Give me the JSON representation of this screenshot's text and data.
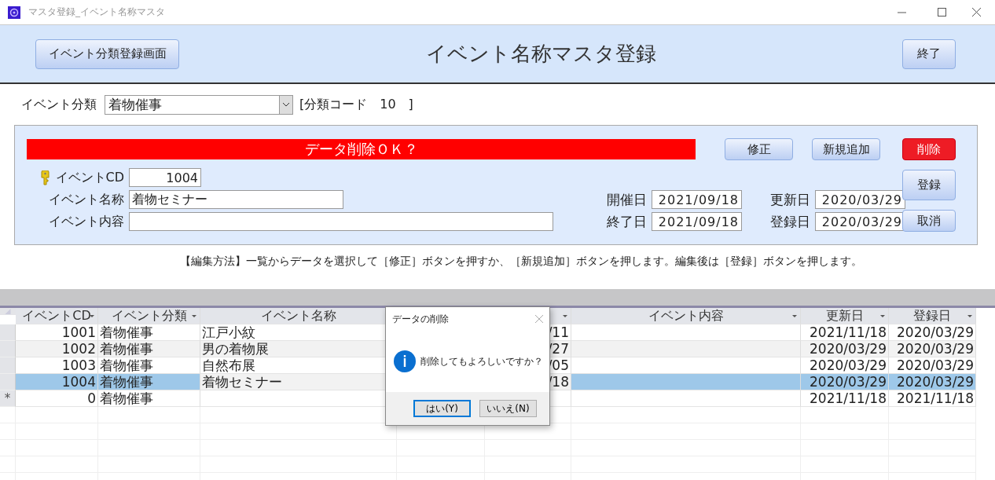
{
  "window": {
    "title": "マスタ登録_イベント名称マスタ"
  },
  "header": {
    "nav_button": "イベント分類登録画面",
    "title": "イベント名称マスタ登録",
    "close_button": "終了"
  },
  "category": {
    "label": "イベント分類",
    "value": "着物催事",
    "code_text": "[分類コード　10　]"
  },
  "editor": {
    "alert": "データ削除ＯＫ？",
    "top_buttons": [
      {
        "label": "修正",
        "kind": "normal"
      },
      {
        "label": "新規追加",
        "kind": "normal"
      }
    ],
    "side_buttons": [
      {
        "label": "削除",
        "kind": "danger"
      },
      {
        "label": "登録",
        "kind": "tall"
      },
      {
        "label": "取消",
        "kind": "normal"
      }
    ],
    "fields": [
      {
        "label": "イベントCD",
        "value": "1004",
        "kind": "key"
      },
      {
        "label": "イベント名称",
        "value": "着物セミナー",
        "kind": "text"
      },
      {
        "label": "イベント内容",
        "kind": "wide"
      }
    ],
    "dates": [
      {
        "label": "開催日",
        "value": "2021/09/18"
      },
      {
        "label": "更新日",
        "value": "2020/03/29"
      },
      {
        "label": "終了日",
        "value": "2021/09/18"
      },
      {
        "label": "登録日",
        "value": "2020/03/29"
      }
    ]
  },
  "instructions": "【編集方法】一覧からデータを選択して［修正］ボタンを押すか、［新規追加］ボタンを押します。編集後は［登録］ボタンを押します。",
  "grid": {
    "columns": [
      {
        "label": "イベントCD",
        "filter": true,
        "in_selection": true
      },
      {
        "label": "イベント分類",
        "filter": true,
        "in_selection": true
      },
      {
        "label": "イベント名称",
        "in_selection": false
      },
      {
        "filter": true,
        "in_selection": false
      },
      {
        "label": "イベント内容",
        "filter": true,
        "in_selection": true
      },
      {
        "label": "更新日",
        "filter": true,
        "in_selection": true
      },
      {
        "label": "登録日",
        "filter": true,
        "in_selection": true
      }
    ],
    "rows": [
      {
        "kind": "record",
        "selected": false,
        "cells": [
          "1001",
          "着物催事",
          "江戸小紋",
          "/11",
          null,
          "2021/11/18",
          "2020/03/29"
        ]
      },
      {
        "kind": "record",
        "selected": false,
        "cells": [
          "1002",
          "着物催事",
          "男の着物展",
          "/27",
          null,
          "2020/03/29",
          "2020/03/29"
        ]
      },
      {
        "kind": "record",
        "selected": false,
        "cells": [
          "1003",
          "着物催事",
          "自然布展",
          "/05",
          null,
          "2020/03/29",
          "2020/03/29"
        ]
      },
      {
        "kind": "record",
        "selected": true,
        "cells": [
          "1004",
          "着物催事",
          "着物セミナー",
          "/18",
          null,
          "2020/03/29",
          "2020/03/29"
        ]
      },
      {
        "kind": "new",
        "marker": "*",
        "selected": false,
        "cells": [
          "0",
          "着物催事",
          null,
          null,
          null,
          "2021/11/18",
          "2021/11/18"
        ]
      }
    ]
  },
  "dialog": {
    "title": "データの削除",
    "message": "削除してもよろしいですか？",
    "buttons": [
      {
        "label": "はい(Y)",
        "default": true
      },
      {
        "label": "いいえ(N)",
        "default": false
      }
    ]
  }
}
